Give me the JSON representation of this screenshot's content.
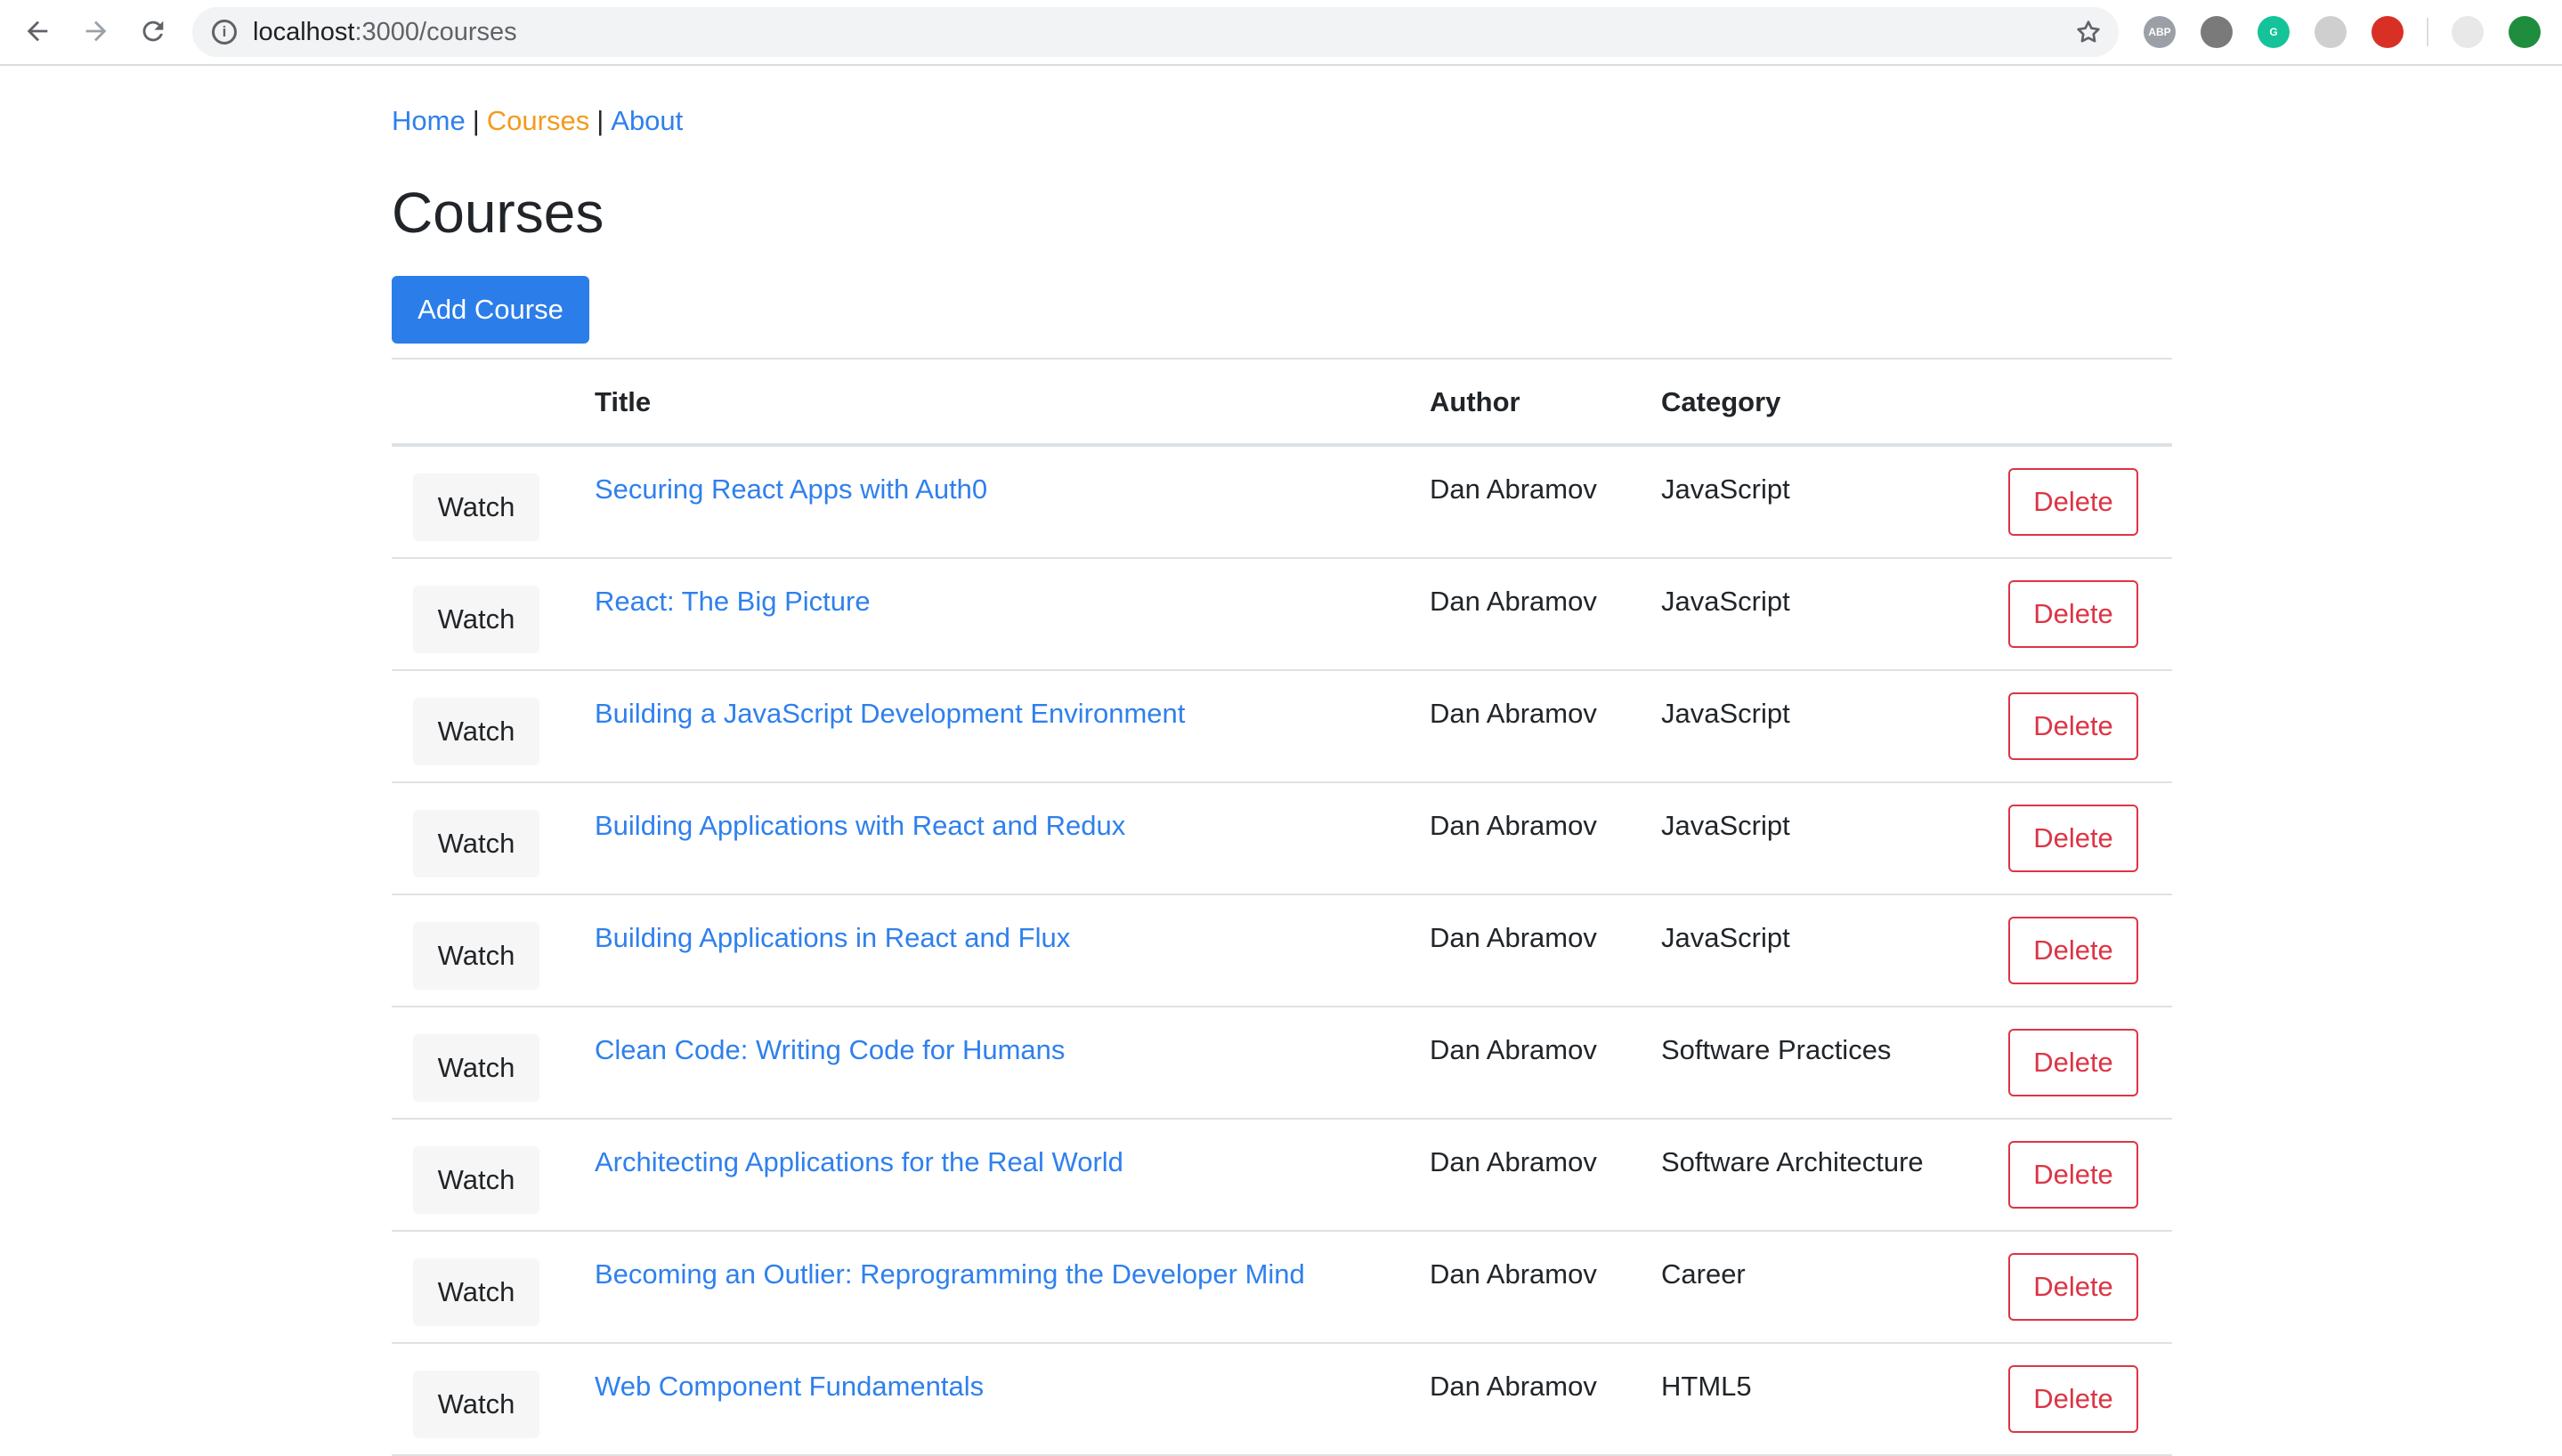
{
  "browser": {
    "url_host": "localhost",
    "url_path": ":3000/courses",
    "extensions": [
      {
        "name": "adblock-plus-icon",
        "label": "ABP",
        "color": "#9aa0a6"
      },
      {
        "name": "vue-devtools-icon",
        "label": "",
        "color": "#7a7a7a"
      },
      {
        "name": "grammarly-icon",
        "label": "G",
        "color": "#15c39a"
      },
      {
        "name": "timer-extension-icon",
        "label": "",
        "color": "#cfcfcf"
      },
      {
        "name": "red-extension-icon",
        "label": "",
        "color": "#d93025"
      },
      {
        "name": "eyes-extension-icon",
        "label": "",
        "color": "#e8e8e8"
      },
      {
        "name": "upload-extension-icon",
        "label": "",
        "color": "#1e8e3e"
      }
    ]
  },
  "nav": {
    "home": "Home",
    "separator": "|",
    "courses": "Courses",
    "about": "About"
  },
  "page": {
    "title": "Courses",
    "add_button": "Add Course"
  },
  "table": {
    "headers": {
      "title": "Title",
      "author": "Author",
      "category": "Category"
    },
    "watch_label": "Watch",
    "delete_label": "Delete",
    "rows": [
      {
        "title": "Securing React Apps with Auth0",
        "author": "Dan Abramov",
        "category": "JavaScript"
      },
      {
        "title": "React: The Big Picture",
        "author": "Dan Abramov",
        "category": "JavaScript"
      },
      {
        "title": "Building a JavaScript Development Environment",
        "author": "Dan Abramov",
        "category": "JavaScript"
      },
      {
        "title": "Building Applications with React and Redux",
        "author": "Dan Abramov",
        "category": "JavaScript"
      },
      {
        "title": "Building Applications in React and Flux",
        "author": "Dan Abramov",
        "category": "JavaScript"
      },
      {
        "title": "Clean Code: Writing Code for Humans",
        "author": "Dan Abramov",
        "category": "Software Practices"
      },
      {
        "title": "Architecting Applications for the Real World",
        "author": "Dan Abramov",
        "category": "Software Architecture"
      },
      {
        "title": "Becoming an Outlier: Reprogramming the Developer Mind",
        "author": "Dan Abramov",
        "category": "Career"
      },
      {
        "title": "Web Component Fundamentals",
        "author": "Dan Abramov",
        "category": "HTML5"
      }
    ]
  }
}
